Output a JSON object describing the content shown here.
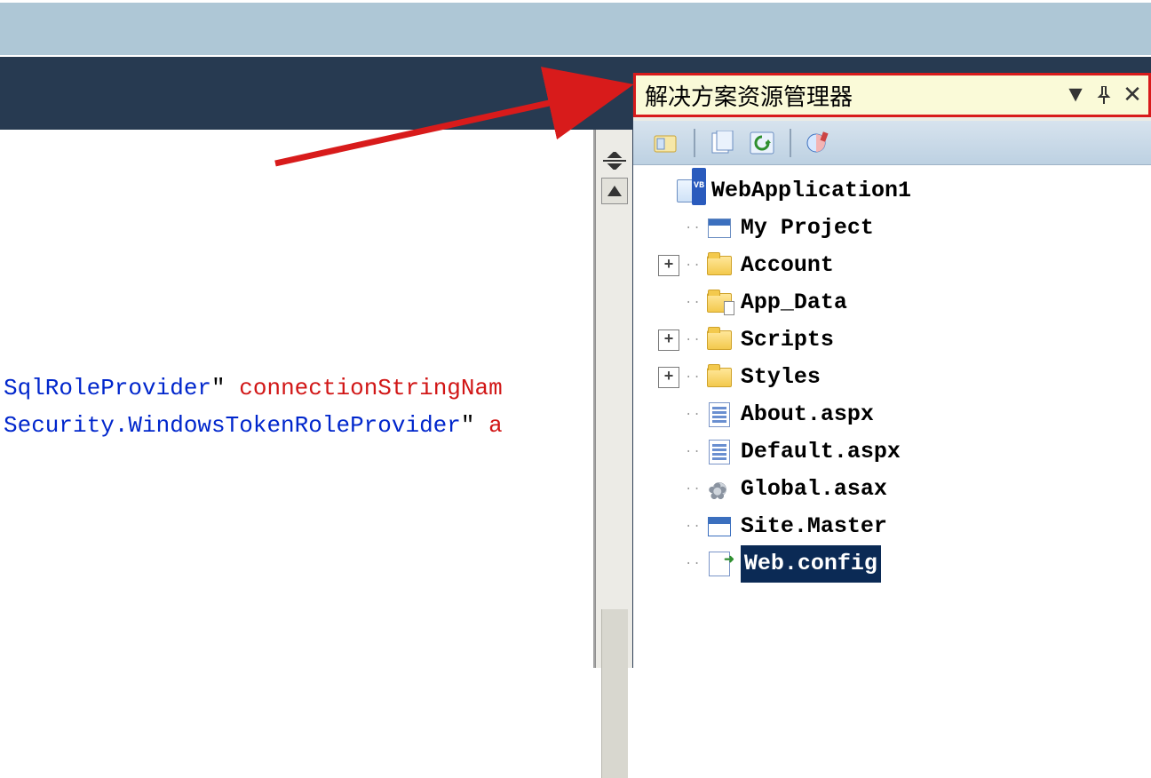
{
  "editor": {
    "line1": {
      "a": "SqlRoleProvider",
      "q": "\"",
      "sp": " ",
      "b": "connectionStringNam"
    },
    "line2": {
      "a": "Security.WindowsTokenRoleProvider",
      "q": "\"",
      "sp": " ",
      "b": "a"
    }
  },
  "panel": {
    "title": "解决方案资源管理器",
    "toolbar_icons": [
      "properties-icon",
      "show-all-files-icon",
      "refresh-icon",
      "view-designer-icon"
    ]
  },
  "tree": {
    "root": "WebApplication1",
    "items": [
      {
        "expander": "",
        "icon": "project-settings",
        "label": "My Project"
      },
      {
        "expander": "+",
        "icon": "folder",
        "label": "Account"
      },
      {
        "expander": "",
        "icon": "folder-data",
        "label": "App_Data"
      },
      {
        "expander": "+",
        "icon": "folder",
        "label": "Scripts"
      },
      {
        "expander": "+",
        "icon": "folder",
        "label": "Styles"
      },
      {
        "expander": "",
        "icon": "aspx",
        "label": "About.aspx"
      },
      {
        "expander": "",
        "icon": "aspx",
        "label": "Default.aspx"
      },
      {
        "expander": "",
        "icon": "asax",
        "label": "Global.asax"
      },
      {
        "expander": "",
        "icon": "master",
        "label": "Site.Master"
      },
      {
        "expander": "",
        "icon": "config",
        "label": "Web.config",
        "selected": true
      }
    ]
  },
  "colors": {
    "annotation_red": "#d81b1b",
    "dark_band": "#273a51",
    "top_strip": "#aec7d6"
  }
}
